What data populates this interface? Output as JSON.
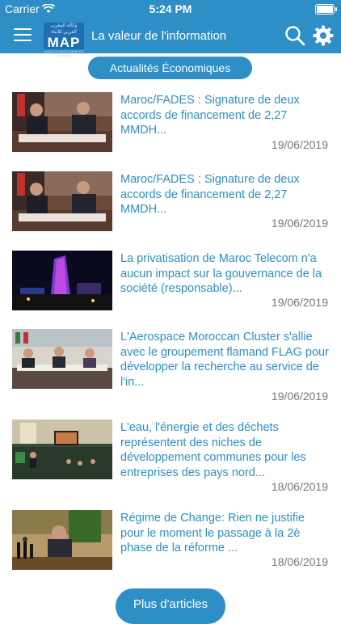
{
  "status": {
    "carrier": "Carrier",
    "time": "5:24 PM"
  },
  "header": {
    "logo_text": "MAP",
    "logo_arabic": "وكالة المغرب العربي للأنباء",
    "logo_small": "AGENCE MAROCAINE DE PRESSE",
    "title": "La valeur de l'information"
  },
  "section": {
    "label": "Actualités Économiques"
  },
  "articles": [
    {
      "title": "Maroc/FADES : Signature de deux accords de financement de 2,27 MMDH...",
      "date": "19/06/2019"
    },
    {
      "title": "Maroc/FADES : Signature de deux accords de financement de 2,27 MMDH...",
      "date": "19/06/2019"
    },
    {
      "title": "La privatisation de Maroc Telecom n'a aucun impact sur la gouvernance de la société (responsable)...",
      "date": "19/06/2019"
    },
    {
      "title": "L'Aerospace Moroccan Cluster s'allie avec le groupement flamand FLAG pour développer la recherche au service de l'in...",
      "date": "19/06/2019"
    },
    {
      "title": "L'eau, l'énergie et des déchets représentent des niches de développement communes pour les entreprises des pays nord...",
      "date": "18/06/2019"
    },
    {
      "title": "Régime de Change: Rien ne justifie pour le moment le passage à la 2è phase de la réforme ...",
      "date": "18/06/2019"
    }
  ],
  "more_button": {
    "label": "Plus d'articles"
  },
  "colors": {
    "brand": "#2d8fc6",
    "date": "#777777"
  }
}
